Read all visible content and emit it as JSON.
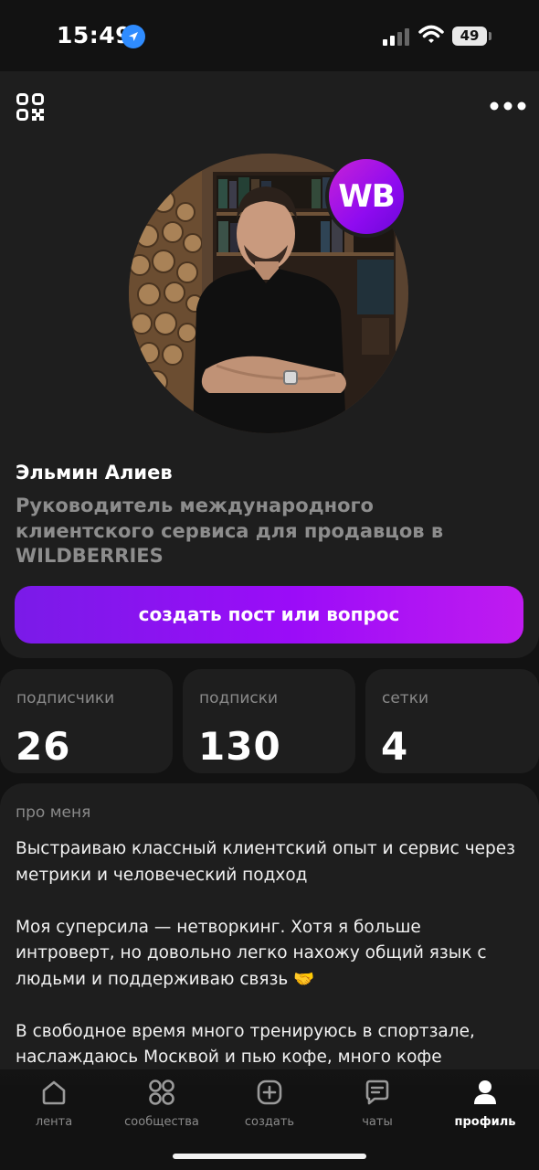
{
  "status_bar": {
    "time": "15:49",
    "battery": "49"
  },
  "profile": {
    "name": "Эльмин Алиев",
    "subtitle": "Руководитель международного клиентского сервиса для продавцов в WILDBERRIES",
    "badge": "WB",
    "create_button": "создать пост или вопрос"
  },
  "stats": [
    {
      "label": "подписчики",
      "value": "26"
    },
    {
      "label": "подписки",
      "value": "130"
    },
    {
      "label": "сетки",
      "value": "4"
    }
  ],
  "about": {
    "title": "про меня",
    "paragraphs": [
      "Выстраиваю классный клиентский опыт и сервис через метрики и человеческий подход",
      "Моя суперсила — нетворкинг. Хотя я больше интроверт, но довольно легко нахожу общий язык с людьми и поддерживаю связь 🤝",
      "В свободное время много тренируюсь в спортзале, наслаждаюсь Москвой и пью кофе, много кофе"
    ]
  },
  "tabbar": {
    "items": [
      {
        "label": "лента",
        "icon": "home-icon"
      },
      {
        "label": "сообщества",
        "icon": "grid-icon"
      },
      {
        "label": "создать",
        "icon": "plus-square-icon"
      },
      {
        "label": "чаты",
        "icon": "chat-icon"
      },
      {
        "label": "профиль",
        "icon": "profile-icon",
        "active": true
      }
    ]
  },
  "colors": {
    "accent_start": "#7a1be8",
    "accent_end": "#c01bf0",
    "background": "#121212",
    "card": "#1e1e1e"
  }
}
